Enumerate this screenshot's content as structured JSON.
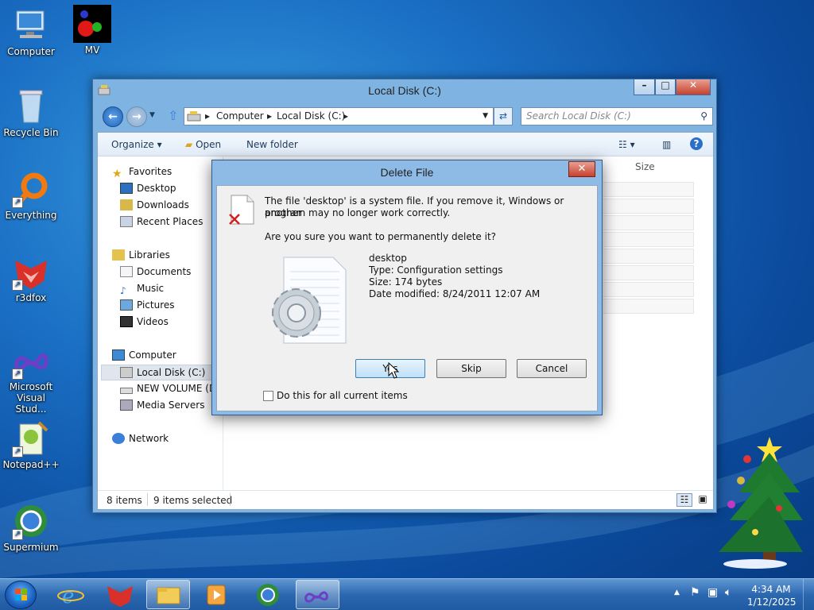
{
  "desktop": {
    "icons": [
      {
        "label": "Computer"
      },
      {
        "label": "MV"
      },
      {
        "label": "Recycle Bin"
      },
      {
        "label": "Everything"
      },
      {
        "label": "r3dfox"
      },
      {
        "label": "Microsoft Visual Stud..."
      },
      {
        "label": "Notepad++"
      },
      {
        "label": "Supermium"
      }
    ]
  },
  "explorer": {
    "title": "Local Disk (C:)",
    "breadcrumb": [
      "Computer",
      "Local Disk (C:)"
    ],
    "search_placeholder": "Search Local Disk (C:)",
    "toolbar": {
      "organize": "Organize",
      "open": "Open",
      "new_folder": "New folder"
    },
    "column_size": "Size",
    "nav": {
      "favorites": "Favorites",
      "favorites_items": [
        "Desktop",
        "Downloads",
        "Recent Places"
      ],
      "libraries": "Libraries",
      "libraries_items": [
        "Documents",
        "Music",
        "Pictures",
        "Videos"
      ],
      "computer": "Computer",
      "computer_items": [
        "Local Disk (C:)",
        "NEW VOLUME (D:",
        "Media Servers"
      ],
      "network": "Network"
    },
    "status": {
      "items": "8 items",
      "selected": "9 items selected"
    }
  },
  "dialog": {
    "title": "Delete File",
    "message_line1": "The file 'desktop' is a system file. If you remove it, Windows or another",
    "message_line2": "program may no longer work correctly.",
    "question": "Are you sure you want to permanently delete it?",
    "file_name": "desktop",
    "file_type": "Type: Configuration settings",
    "file_size": "Size: 174 bytes",
    "file_modified": "Date modified: 8/24/2011 12:07 AM",
    "yes": "Yes",
    "skip": "Skip",
    "cancel": "Cancel",
    "checkbox_label": "Do this for all current items",
    "checkbox_checked": false
  },
  "taskbar": {
    "time": "4:34 AM",
    "date": "1/12/2025"
  },
  "colors": {
    "desktop_bg": "#1a6fc4",
    "window_frame": "#7fb4e2",
    "dialog_frame": "#8ebbe6",
    "close_button": "#c7402c"
  }
}
